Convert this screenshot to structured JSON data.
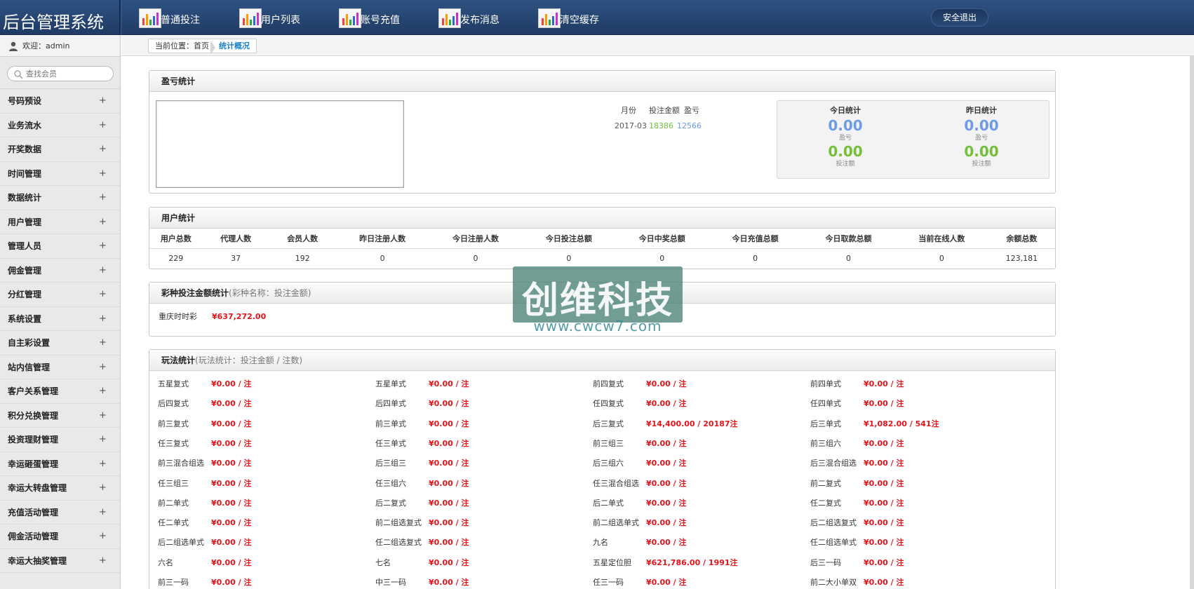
{
  "app": {
    "title": "后台管理系统"
  },
  "topnav": [
    {
      "label": "普通投注"
    },
    {
      "label": "用户列表"
    },
    {
      "label": "账号充值"
    },
    {
      "label": "发布消息"
    },
    {
      "label": "清空缓存"
    }
  ],
  "logout_label": "安全退出",
  "sidebar": {
    "welcome": "欢迎：admin",
    "search_placeholder": "查找会员",
    "items": [
      {
        "label": "号码预设"
      },
      {
        "label": "业务流水"
      },
      {
        "label": "开奖数据"
      },
      {
        "label": "时间管理"
      },
      {
        "label": "数据统计"
      },
      {
        "label": "用户管理"
      },
      {
        "label": "管理人员"
      },
      {
        "label": "佣金管理"
      },
      {
        "label": "分红管理"
      },
      {
        "label": "系统设置"
      },
      {
        "label": "自主彩设置"
      },
      {
        "label": "站内信管理"
      },
      {
        "label": "客户关系管理"
      },
      {
        "label": "积分兑换管理"
      },
      {
        "label": "投资理财管理"
      },
      {
        "label": "幸运砸蛋管理"
      },
      {
        "label": "幸运大转盘管理"
      },
      {
        "label": "充值活动管理"
      },
      {
        "label": "佣金活动管理"
      },
      {
        "label": "幸运大抽奖管理"
      }
    ],
    "plus": "+"
  },
  "breadcrumb": {
    "prefix": "当前位置：首页",
    "current": "统计概况"
  },
  "profit": {
    "title": "盈亏统计",
    "headers": [
      "月份",
      "投注金额",
      "盈亏"
    ],
    "row": {
      "month": "2017-03",
      "bet": "18386",
      "profit": "12566"
    },
    "today": {
      "title": "今日统计",
      "profit": "0.00",
      "profit_label": "盈亏",
      "bet": "0.00",
      "bet_label": "投注额"
    },
    "yesterday": {
      "title": "昨日统计",
      "profit": "0.00",
      "profit_label": "盈亏",
      "bet": "0.00",
      "bet_label": "投注额"
    }
  },
  "users": {
    "title": "用户统计",
    "headers": [
      "用户总数",
      "代理人数",
      "会员人数",
      "昨日注册人数",
      "今日注册人数",
      "今日投注总额",
      "今日中奖总额",
      "今日充值总额",
      "今日取款总额",
      "当前在线人数",
      "余额总数"
    ],
    "values": [
      "229",
      "37",
      "192",
      "0",
      "0",
      "0",
      "0",
      "0",
      "0",
      "0",
      "123,181"
    ]
  },
  "lottery": {
    "title": "彩种投注金额统计",
    "hint": "(彩种名称：投注金额)",
    "items": [
      {
        "name": "重庆时时彩",
        "value": "¥637,272.00"
      }
    ]
  },
  "plays": {
    "title": "玩法统计",
    "hint": "(玩法统计：投注金额 / 注数)",
    "items": [
      {
        "name": "五星复式",
        "value": "¥0.00 / 注"
      },
      {
        "name": "五星单式",
        "value": "¥0.00 / 注"
      },
      {
        "name": "前四复式",
        "value": "¥0.00 / 注"
      },
      {
        "name": "前四单式",
        "value": "¥0.00 / 注"
      },
      {
        "name": "后四复式",
        "value": "¥0.00 / 注"
      },
      {
        "name": "后四单式",
        "value": "¥0.00 / 注"
      },
      {
        "name": "任四复式",
        "value": "¥0.00 / 注"
      },
      {
        "name": "任四单式",
        "value": "¥0.00 / 注"
      },
      {
        "name": "前三复式",
        "value": "¥0.00 / 注"
      },
      {
        "name": "前三单式",
        "value": "¥0.00 / 注"
      },
      {
        "name": "后三复式",
        "value": "¥14,400.00 / 20187注"
      },
      {
        "name": "后三单式",
        "value": "¥1,082.00 / 541注"
      },
      {
        "name": "任三复式",
        "value": "¥0.00 / 注"
      },
      {
        "name": "任三单式",
        "value": "¥0.00 / 注"
      },
      {
        "name": "前三组三",
        "value": "¥0.00 / 注"
      },
      {
        "name": "前三组六",
        "value": "¥0.00 / 注"
      },
      {
        "name": "前三混合组选",
        "value": "¥0.00 / 注"
      },
      {
        "name": "后三组三",
        "value": "¥0.00 / 注"
      },
      {
        "name": "后三组六",
        "value": "¥0.00 / 注"
      },
      {
        "name": "后三混合组选",
        "value": "¥0.00 / 注"
      },
      {
        "name": "任三组三",
        "value": "¥0.00 / 注"
      },
      {
        "name": "任三组六",
        "value": "¥0.00 / 注"
      },
      {
        "name": "任三混合组选",
        "value": "¥0.00 / 注"
      },
      {
        "name": "前二复式",
        "value": "¥0.00 / 注"
      },
      {
        "name": "前二单式",
        "value": "¥0.00 / 注"
      },
      {
        "name": "后二复式",
        "value": "¥0.00 / 注"
      },
      {
        "name": "后二单式",
        "value": "¥0.00 / 注"
      },
      {
        "name": "任二复式",
        "value": "¥0.00 / 注"
      },
      {
        "name": "任二单式",
        "value": "¥0.00 / 注"
      },
      {
        "name": "前二组选复式",
        "value": "¥0.00 / 注"
      },
      {
        "name": "前二组选单式",
        "value": "¥0.00 / 注"
      },
      {
        "name": "后二组选复式",
        "value": "¥0.00 / 注"
      },
      {
        "name": "后二组选单式",
        "value": "¥0.00 / 注"
      },
      {
        "name": "任二组选复式",
        "value": "¥0.00 / 注"
      },
      {
        "name": "九名",
        "value": "¥0.00 / 注"
      },
      {
        "name": "任二组选单式",
        "value": "¥0.00 / 注"
      },
      {
        "name": "六名",
        "value": "¥0.00 / 注"
      },
      {
        "name": "七名",
        "value": "¥0.00 / 注"
      },
      {
        "name": "五星定位胆",
        "value": "¥621,786.00 / 1991注"
      },
      {
        "name": "后三一码",
        "value": "¥0.00 / 注"
      },
      {
        "name": "前三一码",
        "value": "¥0.00 / 注"
      },
      {
        "name": "中三一码",
        "value": "¥0.00 / 注"
      },
      {
        "name": "任三一码",
        "value": "¥0.00 / 注"
      },
      {
        "name": "前二大小单双",
        "value": "¥0.00 / 注"
      }
    ]
  },
  "watermark": {
    "main": "创维科技",
    "url": "www.cwcw7.com"
  },
  "colors": {
    "header": "#2a4a77",
    "accent_blue": "#6d9be8",
    "accent_green": "#74bf3a",
    "money_red": "#e4141b",
    "link_blue": "#1c83c6"
  }
}
